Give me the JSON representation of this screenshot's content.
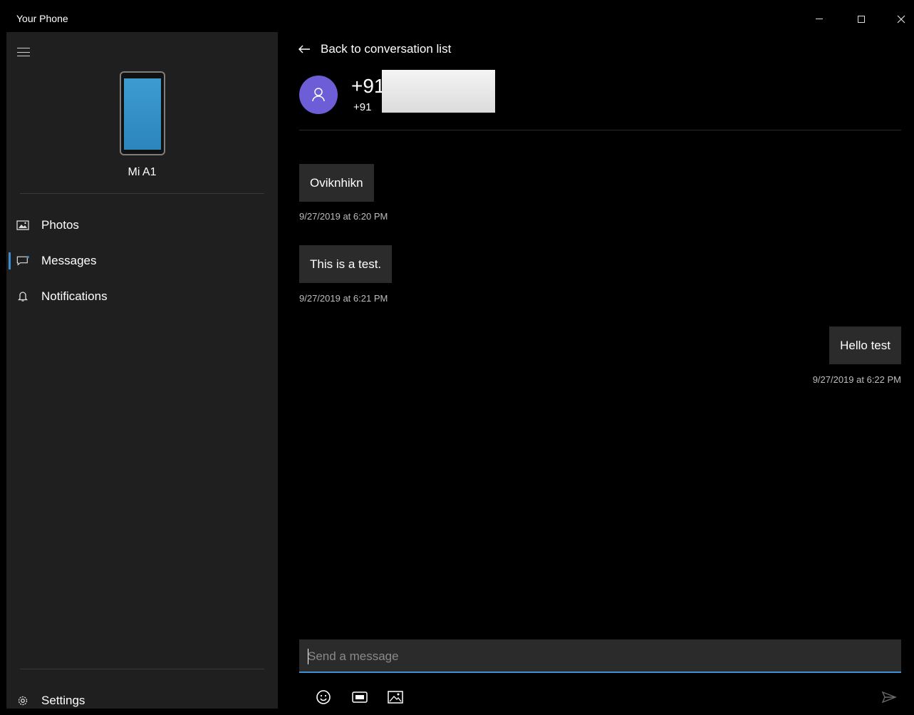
{
  "window": {
    "title": "Your Phone"
  },
  "sidebar": {
    "device_name": "Mi A1",
    "items": [
      {
        "label": "Photos",
        "icon": "photos-icon",
        "active": false
      },
      {
        "label": "Messages",
        "icon": "messages-icon",
        "active": true
      },
      {
        "label": "Notifications",
        "icon": "bell-icon",
        "active": false
      }
    ],
    "settings_label": "Settings"
  },
  "conversation": {
    "back_label": "Back to conversation list",
    "contact_name": "+91",
    "contact_number": "+91",
    "messages": [
      {
        "text": "Oviknhikn",
        "timestamp": "9/27/2019 at 6:20 PM",
        "direction": "received"
      },
      {
        "text": "This is a test.",
        "timestamp": "9/27/2019 at 6:21 PM",
        "direction": "received"
      },
      {
        "text": "Hello test",
        "timestamp": "9/27/2019 at 6:22 PM",
        "direction": "sent"
      }
    ],
    "composer_placeholder": "Send a message"
  },
  "colors": {
    "accent": "#3d8fd1",
    "avatar": "#6d5ed8",
    "sidebar_bg": "#1f1f1f",
    "bubble_bg": "#2b2b2b"
  }
}
